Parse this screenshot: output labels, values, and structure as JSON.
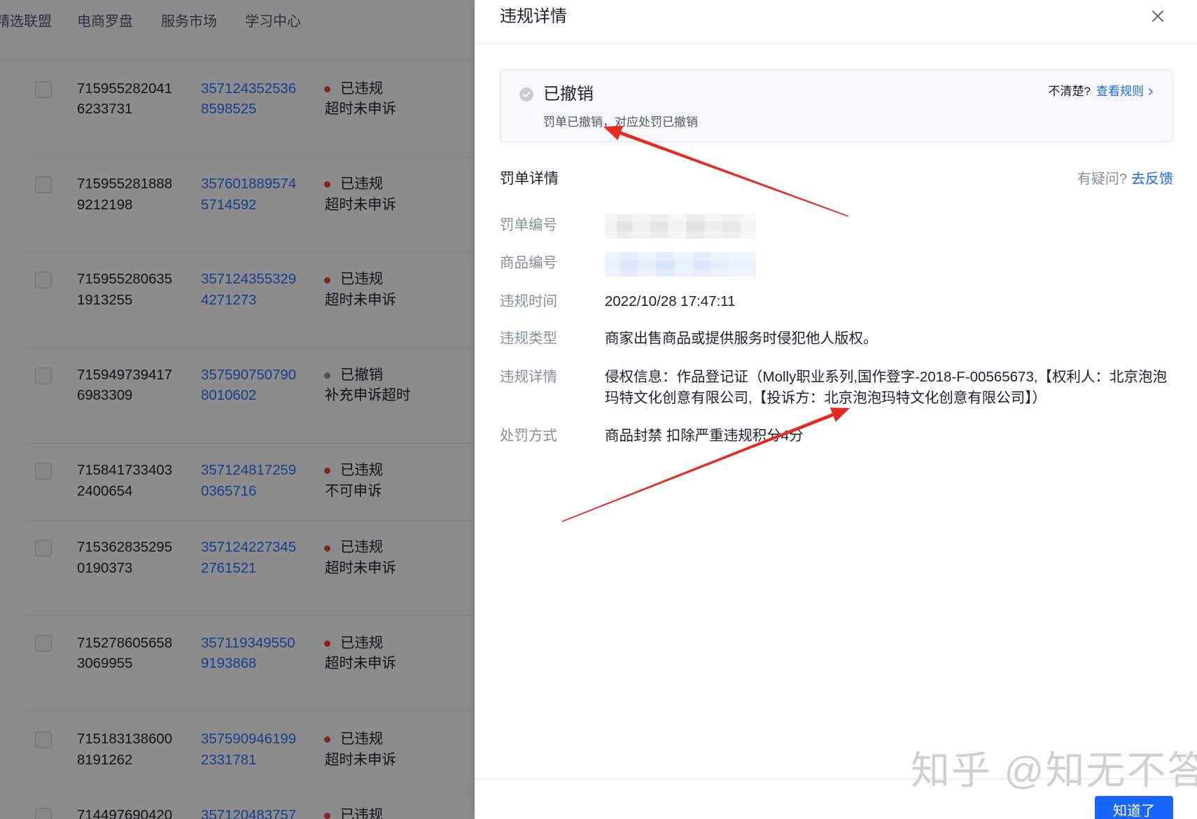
{
  "page": {
    "nav": {
      "items": [
        "精选联盟",
        "电商罗盘",
        "服务市场",
        "学习中心"
      ]
    },
    "violation_list": {
      "rows": [
        {
          "order_id": [
            "715955282041",
            "6233731"
          ],
          "product_id": [
            "357124352536",
            "8598525"
          ],
          "status": "已违规",
          "sub_status": "超时未申诉",
          "dot_color": "#f53f3f"
        },
        {
          "order_id": [
            "715955281888",
            "9212198"
          ],
          "product_id": [
            "357601889574",
            "5714592"
          ],
          "status": "已违规",
          "sub_status": "超时未申诉",
          "dot_color": "#f53f3f"
        },
        {
          "order_id": [
            "715955280635",
            "1913255"
          ],
          "product_id": [
            "357124355329",
            "4271273"
          ],
          "status": "已违规",
          "sub_status": "超时未申诉",
          "dot_color": "#f53f3f"
        },
        {
          "order_id": [
            "715949739417",
            "6983309"
          ],
          "product_id": [
            "357590750790",
            "8010602"
          ],
          "status": "已撤销",
          "sub_status": "补充申诉超时",
          "dot_color": "#86909c"
        },
        {
          "order_id": [
            "715841733403",
            "2400654"
          ],
          "product_id": [
            "357124817259",
            "0365716"
          ],
          "status": "已违规",
          "sub_status": "不可申诉",
          "dot_color": "#f53f3f"
        },
        {
          "order_id": [
            "715362835295",
            "0190373"
          ],
          "product_id": [
            "357124227345",
            "2761521"
          ],
          "status": "已违规",
          "sub_status": "超时未申诉",
          "dot_color": "#f53f3f"
        },
        {
          "order_id": [
            "715278605658",
            "3069955"
          ],
          "product_id": [
            "357119349550",
            "9193868"
          ],
          "status": "已违规",
          "sub_status": "超时未申诉",
          "dot_color": "#f53f3f"
        },
        {
          "order_id": [
            "715183138600",
            "8191262"
          ],
          "product_id": [
            "357590946199",
            "2331781"
          ],
          "status": "已违规",
          "sub_status": "超时未申诉",
          "dot_color": "#f53f3f"
        },
        {
          "order_id": [
            "714497690420"
          ],
          "product_id": [
            "357120483757"
          ],
          "status": "已违规",
          "dot_color": "#f53f3f"
        }
      ]
    }
  },
  "drawer": {
    "title": "违规详情",
    "close_icon": "close-icon",
    "status_card": {
      "icon": "check-circle-icon",
      "status": "已撤销",
      "description": "罚单已撤销，对应处罚已撤销",
      "hint": "不清楚?",
      "rules_link": "查看规则",
      "link_icon": "chevron-right-icon"
    },
    "section": {
      "title": "罚单详情",
      "question": "有疑问?",
      "feedback_link": "去反馈"
    },
    "details": [
      {
        "label": "罚单编号",
        "value_obscured": true
      },
      {
        "label": "商品编号",
        "value_obscured": true
      },
      {
        "label": "违规时间",
        "value": "2022/10/28 17:47:11"
      },
      {
        "label": "违规类型",
        "value": "商家出售商品或提供服务时侵犯他人版权。"
      },
      {
        "label": "违规详情",
        "value": "侵权信息：作品登记证（Molly职业系列,国作登字-2018-F-00565673,【权利人：北京泡泡玛特文化创意有限公司,【投诉方：北京泡泡玛特文化创意有限公司】）"
      },
      {
        "label": "处罚方式",
        "value": "商品封禁 扣除严重违规积分4分"
      }
    ],
    "confirm_button": "知道了"
  },
  "watermark": "知乎 @知无不答",
  "colors": {
    "primary": "#1966ff",
    "link": "#3370ff",
    "violation_dot": "#f53f3f",
    "revoked_dot": "#86909c",
    "annotation_arrow": "#e62a1f",
    "overlay": "rgba(0,0,0,0.45)"
  }
}
